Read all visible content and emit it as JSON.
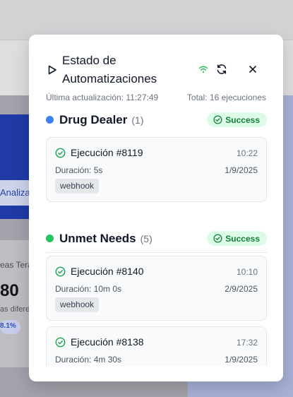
{
  "background": {
    "hero_button_label": "Analiza",
    "card_subtitle": "eas Tera",
    "card_number": "80",
    "card_desc": "as difere",
    "card_badge": "8.1%"
  },
  "modal": {
    "title": "Estado de Automatizaciones",
    "last_update": "Última actualización: 11:27:49",
    "total": "Total: 16 ejecuciones",
    "icons": {
      "play": "play-icon",
      "connection": "wifi-icon",
      "refresh": "refresh-icon",
      "close": "close-icon"
    },
    "colors": {
      "success_text": "#15803d",
      "success_bg": "#dcfce7"
    }
  },
  "groups": [
    {
      "name": "Drug Dealer",
      "count": "(1)",
      "dot_color": "#3b82f6",
      "status": "Success",
      "executions": [
        {
          "title": "Ejecución #8119",
          "time": "10:22",
          "duration": "Duración: 5s",
          "date": "1/9/2025",
          "tag": "webhook"
        }
      ]
    },
    {
      "name": "Unmet Needs",
      "count": "(5)",
      "dot_color": "#22c55e",
      "status": "Success",
      "executions": [
        {
          "title": "Ejecución #8140",
          "time": "10:10",
          "duration": "Duración: 10m 0s",
          "date": "2/9/2025",
          "tag": "webhook"
        },
        {
          "title": "Ejecución #8138",
          "time": "17:32",
          "duration": "Duración: 4m 30s",
          "date": "1/9/2025"
        }
      ]
    }
  ]
}
